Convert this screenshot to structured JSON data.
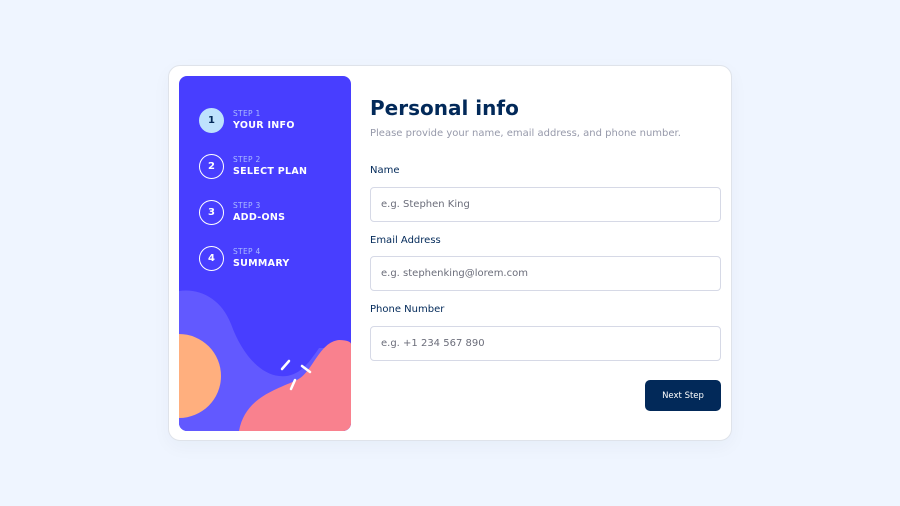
{
  "sidebar": {
    "steps": [
      {
        "label": "STEP 1",
        "title": "YOUR INFO",
        "number": "1",
        "active": true
      },
      {
        "label": "STEP 2",
        "title": "SELECT PLAN",
        "number": "2",
        "active": false
      },
      {
        "label": "STEP 3",
        "title": "ADD-ONS",
        "number": "3",
        "active": false
      },
      {
        "label": "STEP 4",
        "title": "SUMMARY",
        "number": "4",
        "active": false
      }
    ],
    "colors": {
      "background": "#483eff",
      "blob_purple": "#6259ff",
      "blob_orange": "#ffaf7e",
      "blob_pink": "#f9818e",
      "active_circle": "#bee2fd"
    }
  },
  "main": {
    "title": "Personal info",
    "subtitle": "Please provide your name, email address, and phone number.",
    "fields": {
      "name": {
        "label": "Name",
        "placeholder": "e.g. Stephen King",
        "value": ""
      },
      "email": {
        "label": "Email Address",
        "placeholder": "e.g. stephenking@lorem.com",
        "value": ""
      },
      "phone": {
        "label": "Phone Number",
        "placeholder": "e.g. +1 234 567 890",
        "value": ""
      }
    },
    "next_button": "Next Step"
  },
  "colors": {
    "page_background": "#eff5ff",
    "primary_text": "#022959",
    "muted_text": "#9699aa",
    "border": "#d6d9e6",
    "button": "#022959"
  }
}
